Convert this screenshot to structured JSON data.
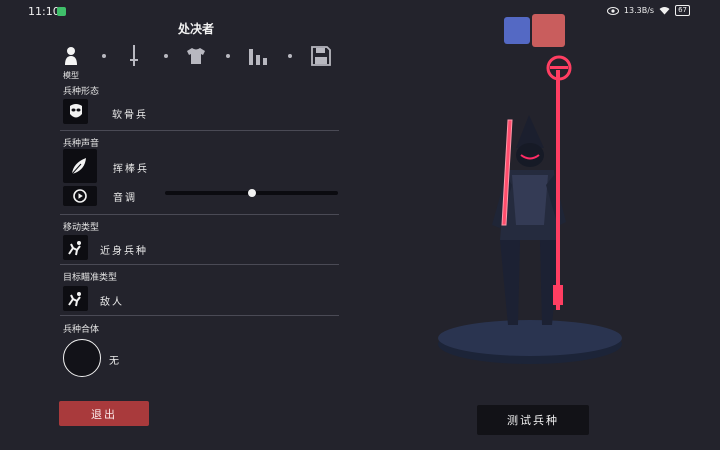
{
  "status": {
    "time": "11:10",
    "network_speed": "13.3B/s",
    "battery": "67"
  },
  "header": {
    "title": "处决者"
  },
  "tabs": [
    {
      "icon": "person-icon"
    },
    {
      "icon": "sword-icon"
    },
    {
      "icon": "shirt-icon"
    },
    {
      "icon": "bars-icon"
    },
    {
      "icon": "save-icon"
    }
  ],
  "tab_label": "模型",
  "sections": {
    "unit_base": {
      "label": "兵种形态",
      "value": "软骨兵"
    },
    "unit_voice": {
      "label": "兵种声音",
      "value": "挥棒兵",
      "pitch_label": "音调",
      "pitch_level": 0.5
    },
    "movement": {
      "label": "移动类型",
      "value": "近身兵种"
    },
    "targeting": {
      "label": "目标瞄准类型",
      "value": "敌人"
    },
    "merge": {
      "label": "兵种合体",
      "value": "无"
    }
  },
  "colors": {
    "primary": "#5469c4",
    "secondary": "#c95d5d"
  },
  "buttons": {
    "exit": "退出",
    "test": "测试兵种"
  }
}
